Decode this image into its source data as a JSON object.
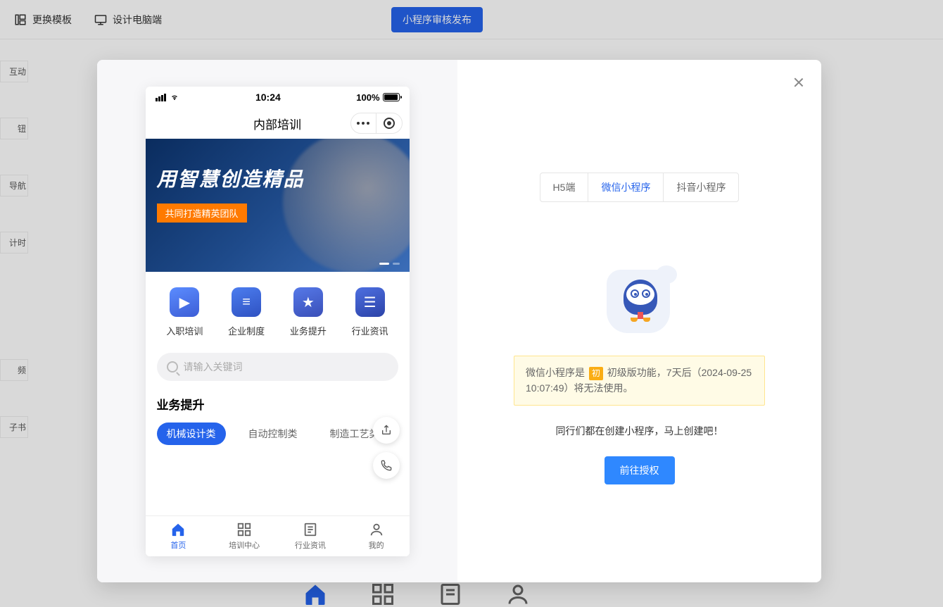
{
  "bg": {
    "templateBtn": "更换模板",
    "designBtn": "设计电脑端",
    "publishBtn": "小程序审核发布",
    "sideItems": [
      "互动",
      "钮",
      "导航",
      "计时",
      "频",
      "子书"
    ]
  },
  "phone": {
    "statusTime": "10:24",
    "batteryPct": "100%",
    "title": "内部培训",
    "heroTitle": "用智慧创造精品",
    "heroSub": "共同打造精英团队",
    "gridItems": [
      {
        "label": "入职培训"
      },
      {
        "label": "企业制度"
      },
      {
        "label": "业务提升"
      },
      {
        "label": "行业资讯"
      }
    ],
    "searchPlaceholder": "请输入关键词",
    "sectionTitle": "业务提升",
    "chips": [
      "机械设计类",
      "自动控制类",
      "制造工艺类"
    ],
    "tabs": [
      {
        "label": "首页"
      },
      {
        "label": "培训中心"
      },
      {
        "label": "行业资讯"
      },
      {
        "label": "我的"
      }
    ]
  },
  "right": {
    "segs": [
      "H5端",
      "微信小程序",
      "抖音小程序"
    ],
    "noticePrefix": "微信小程序是",
    "noticeBadge": "初",
    "noticeSuffix": " 初级版功能，7天后（2024-09-25 10:07:49）将无法使用。",
    "subText": "同行们都在创建小程序，马上创建吧！",
    "authBtn": "前往授权"
  }
}
